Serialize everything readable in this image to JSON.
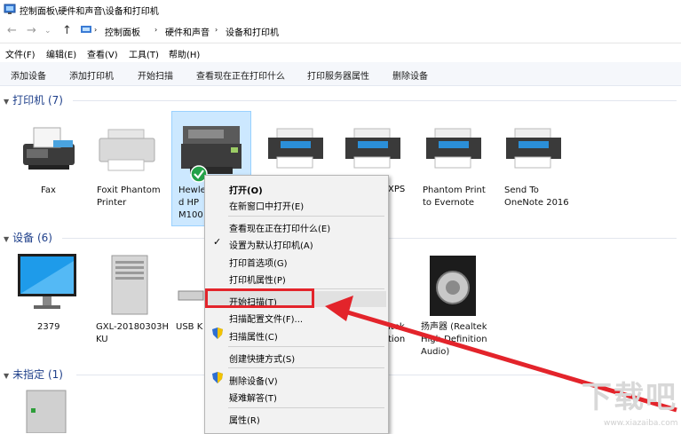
{
  "window": {
    "title": "控制面板\\硬件和声音\\设备和打印机"
  },
  "address": {
    "crumbs": [
      "控制面板",
      "硬件和声音",
      "设备和打印机"
    ]
  },
  "menubar": [
    "文件(F)",
    "编辑(E)",
    "查看(V)",
    "工具(T)",
    "帮助(H)"
  ],
  "commands": [
    "添加设备",
    "添加打印机",
    "开始扫描",
    "查看现在正在打印什么",
    "打印服务器属性",
    "删除设备"
  ],
  "groups": {
    "printers": "打印机 (7)",
    "devices": "设备 (6)",
    "unspecified": "未指定 (1)"
  },
  "printers": [
    {
      "label": "Fax"
    },
    {
      "label": "Foxit Phantom\nPrinter"
    },
    {
      "label": "Hewle\nd HP\nM100"
    },
    {
      "label": "XPS"
    },
    {
      "label": "Phantom Print\nto Evernote"
    },
    {
      "label": "Send To\nOneNote 2016"
    }
  ],
  "devices": [
    {
      "label": "2379"
    },
    {
      "label": "GXL-20180303H\nKU"
    },
    {
      "label": "USB K"
    },
    {
      "label": "ltek\ntion"
    },
    {
      "label": "扬声器 (Realtek\nHigh Definition\nAudio)"
    }
  ],
  "context_menu": {
    "items": [
      "打开(O)",
      "在新窗口中打开(E)",
      "查看现在正在打印什么(E)",
      "设置为默认打印机(A)",
      "打印首选项(G)",
      "打印机属性(P)",
      "开始扫描(T)",
      "扫描配置文件(F)...",
      "扫描属性(C)",
      "创建快捷方式(S)",
      "删除设备(V)",
      "疑难解答(T)",
      "属性(R)"
    ],
    "checked_item": "设置为默认打印机(A)",
    "highlighted_item": "开始扫描(T)"
  },
  "watermark": {
    "text": "下载吧",
    "url": "www.xiazaiba.com"
  },
  "colors": {
    "accent": "#1e3f8a",
    "annotation": "#e3242b",
    "selection": "#cce8ff"
  }
}
